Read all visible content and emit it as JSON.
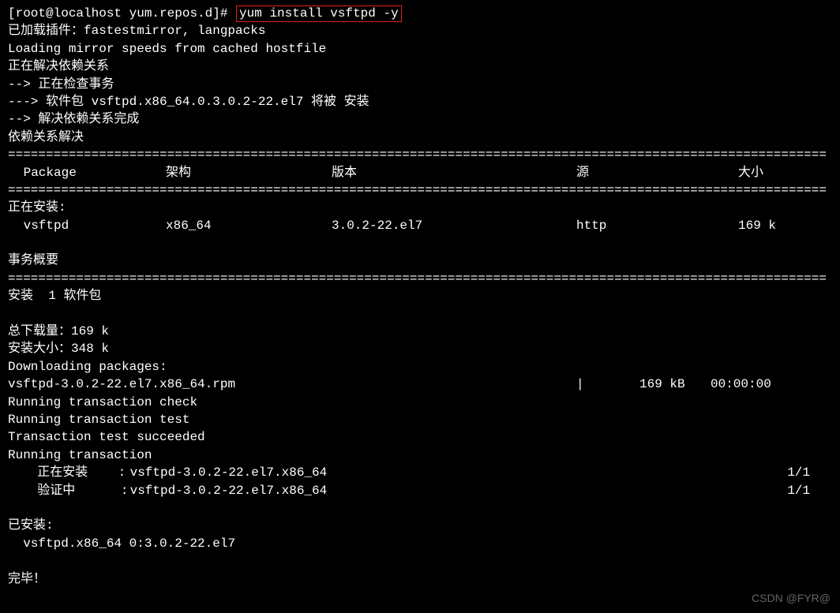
{
  "prompt": "[root@localhost yum.repos.d]# ",
  "command": "yum install vsftpd -y",
  "lines_pre": [
    "已加载插件：fastestmirror, langpacks",
    "Loading mirror speeds from cached hostfile",
    "正在解决依赖关系",
    "--> 正在检查事务",
    "---> 软件包 vsftpd.x86_64.0.3.0.2-22.el7 将被 安装",
    "--> 解决依赖关系完成",
    "",
    "依赖关系解决",
    ""
  ],
  "divider": "============================================================================================================",
  "table": {
    "headers": {
      "package": " Package",
      "arch": "架构",
      "version": "版本",
      "repo": "源",
      "size": "大小"
    },
    "installing_label": "正在安装:",
    "row": {
      "package": " vsftpd",
      "arch": "x86_64",
      "version": "3.0.2-22.el7",
      "repo": "http",
      "size": "169 k"
    }
  },
  "summary_label": "事务概要",
  "install_count": "安装  1 软件包",
  "totals": [
    "总下载量：169 k",
    "安装大小：348 k",
    "Downloading packages:"
  ],
  "download": {
    "file": "vsftpd-3.0.2-22.el7.x86_64.rpm",
    "bar": "|",
    "size": "169 kB",
    "time": "  00:00:00"
  },
  "trans_lines": [
    "Running transaction check",
    "Running transaction test",
    "Transaction test succeeded",
    "Running transaction"
  ],
  "steps": [
    {
      "label": "  正在安装    :",
      "pkg": " vsftpd-3.0.2-22.el7.x86_64",
      "count": "1/1"
    },
    {
      "label": "  验证中      :",
      "pkg": " vsftpd-3.0.2-22.el7.x86_64",
      "count": "1/1"
    }
  ],
  "installed_label": "已安装:",
  "installed_pkg": "  vsftpd.x86_64 0:3.0.2-22.el7",
  "done": "完毕！",
  "watermark": "CSDN @FYR@"
}
